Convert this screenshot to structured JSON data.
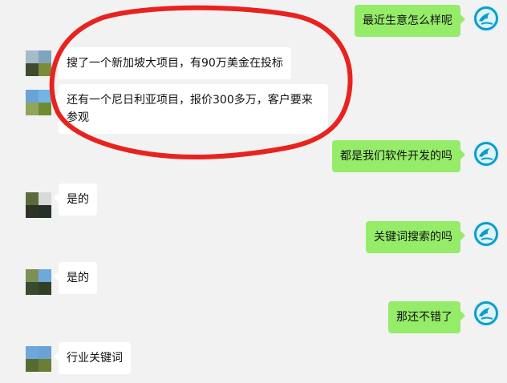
{
  "messages": [
    {
      "side": "right",
      "text": "最近生意怎么样呢"
    },
    {
      "side": "left",
      "text": "搜了一个新加坡大项目，有90万美金在投标"
    },
    {
      "side": "left",
      "text": "还有一个尼日利亚项目，报价300多万，客户要来参观"
    },
    {
      "side": "right",
      "text": "都是我们软件开发的吗"
    },
    {
      "side": "left",
      "text": "是的"
    },
    {
      "side": "right",
      "text": "关键词搜索的吗"
    },
    {
      "side": "left",
      "text": "是的"
    },
    {
      "side": "right",
      "text": "那还不错了"
    },
    {
      "side": "left",
      "text": "行业关键词"
    }
  ],
  "colors": {
    "background": "#f2f2f2",
    "sent_bubble": "#95ec69",
    "received_bubble": "#ffffff",
    "annotation_circle": "#e8231f",
    "avatar_ring": "#0f9cc9"
  },
  "icons": {
    "right_avatar": "crane-logo-icon",
    "left_avatar": "pixelated-avatar-icon"
  }
}
